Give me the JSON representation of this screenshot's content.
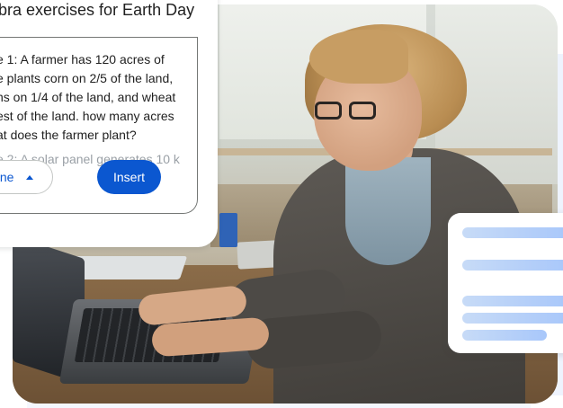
{
  "compose_card": {
    "title": "ebra exercises for Earth Day",
    "exercises": [
      "e 1: A farmer has 120 acres of",
      "e plants corn on 2/5 of the land,",
      "ns on 1/4 of the land, and wheat",
      "est of the land. how many acres",
      "at does the farmer plant?"
    ],
    "faded_line": "e 2: A solar panel generates 10 k",
    "refine_label": "Refine",
    "insert_label": "Insert"
  },
  "colors": {
    "accent_blue": "#0b57d0",
    "text": "#1f1f1f",
    "placeholder_line": "#a8c7fa"
  },
  "icons": {
    "refine_caret": "caret-up-icon"
  }
}
